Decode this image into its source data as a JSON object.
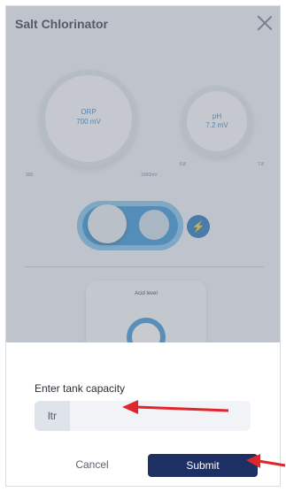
{
  "app": {
    "title": "Salt Chlorinator"
  },
  "gauges": {
    "orp": {
      "title": "ORP",
      "value": "700 mV",
      "min_label": "300",
      "max_label": "1000mV"
    },
    "ph": {
      "title": "pH",
      "value": "7.2 mV",
      "min_label": "6.8",
      "max_label": "7.8"
    }
  },
  "acid": {
    "label": "Acid level"
  },
  "sheet": {
    "label": "Enter tank capacity",
    "unit": "ltr",
    "input_value": "",
    "cancel_label": "Cancel",
    "submit_label": "Submit"
  },
  "colors": {
    "primary": "#1d2f63",
    "accent_blue": "#2f8fd3",
    "arrow_red": "#e0262b"
  }
}
